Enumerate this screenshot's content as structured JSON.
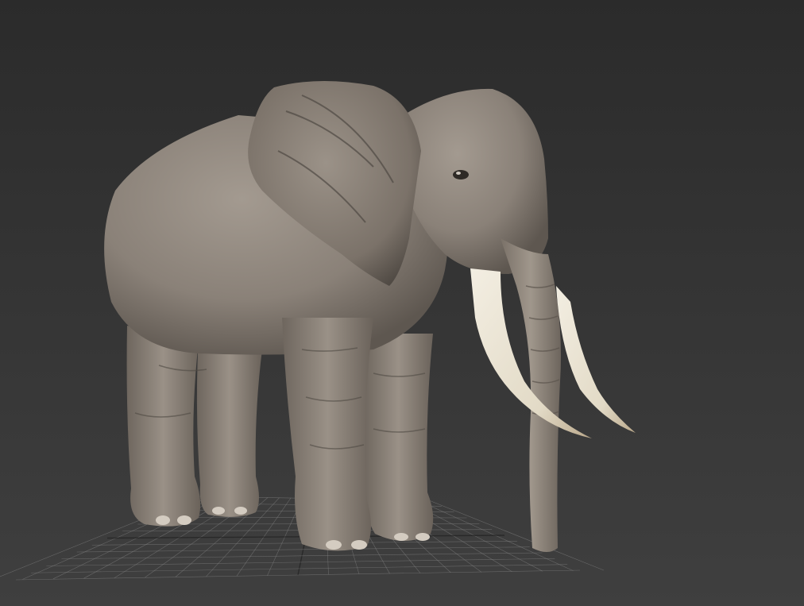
{
  "viewport": {
    "background_top": "#2b2b2b",
    "background_bottom": "#3f3f3f",
    "grid_color": "#8a8a8a",
    "grid_axis_color": "#1a1a1a"
  },
  "model": {
    "skin_color": "#8a8178",
    "skin_shadow_color": "#5e5750",
    "skin_highlight_color": "#a39a90",
    "tusk_color": "#e7e0cf",
    "tusk_tip_color": "#b9a78a"
  }
}
